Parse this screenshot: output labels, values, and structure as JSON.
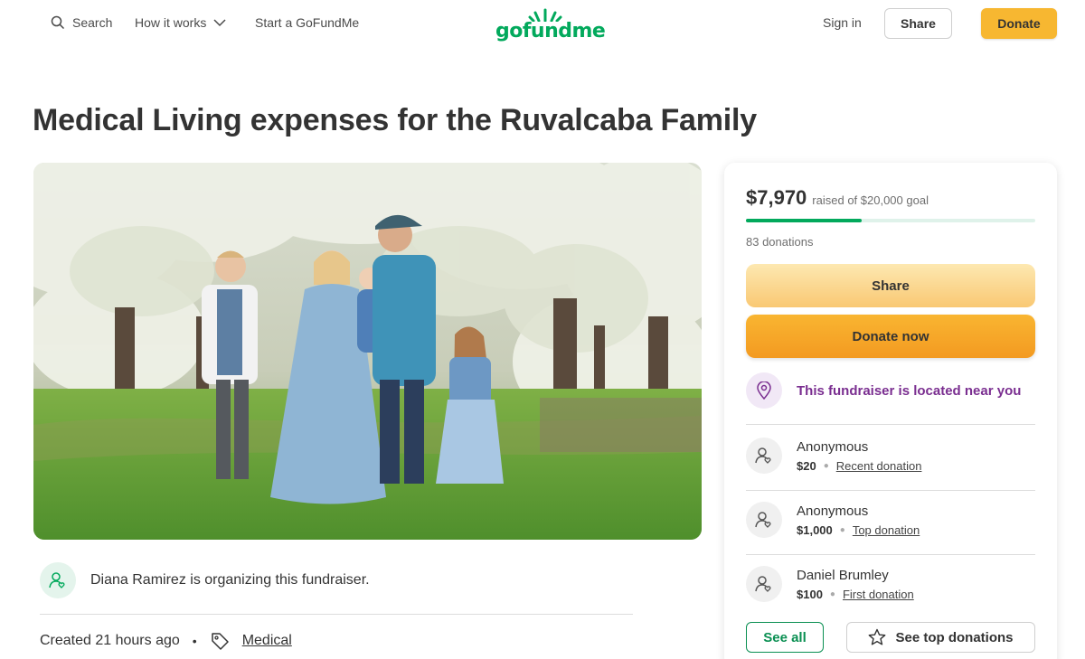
{
  "header": {
    "search_label": "Search",
    "how_it_works_label": "How it works",
    "start_label": "Start a GoFundMe",
    "logo_text": "gofundme",
    "signin_label": "Sign in",
    "share_label": "Share",
    "donate_label": "Donate"
  },
  "campaign": {
    "title": "Medical Living expenses for the Ruvalcaba Family",
    "organizer_text": "Diana Ramirez is organizing this fundraiser.",
    "created": "Created 21 hours ago",
    "category": "Medical"
  },
  "card": {
    "raised_amount": "$7,970",
    "raised_goal": "raised of $20,000 goal",
    "progress_fraction": 0.3985,
    "donations_count": "83 donations",
    "share_label": "Share",
    "donate_label": "Donate now",
    "location_text": "This fundraiser is located near you",
    "donors": [
      {
        "name": "Anonymous",
        "amount": "$20",
        "tag": "Recent donation"
      },
      {
        "name": "Anonymous",
        "amount": "$1,000",
        "tag": "Top donation"
      },
      {
        "name": "Daniel Brumley",
        "amount": "$100",
        "tag": "First donation"
      }
    ],
    "see_all_label": "See all",
    "see_top_label": "See top donations"
  },
  "colors": {
    "brand_green": "#02a95c",
    "donate_orange": "#f7b731",
    "location_purple": "#7a2e90"
  }
}
